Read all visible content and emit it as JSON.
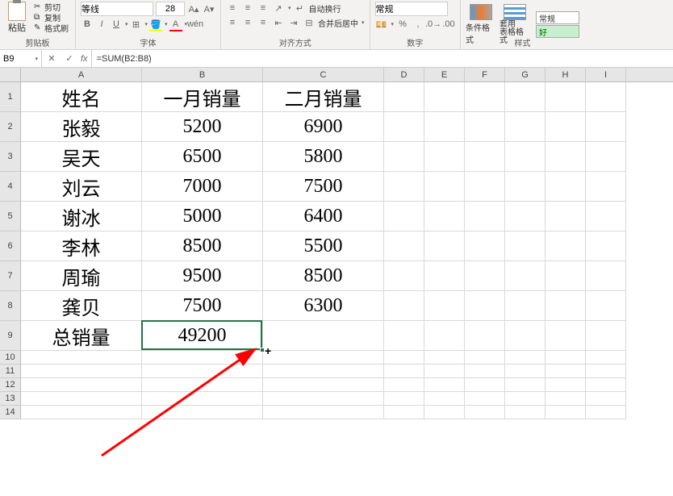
{
  "ribbon": {
    "clipboard": {
      "label": "剪贴板",
      "paste": "粘贴",
      "cut": "剪切",
      "copy": "复制",
      "format_painter": "格式刷"
    },
    "font": {
      "label": "字体",
      "name": "等线",
      "size": "28",
      "bold": "B",
      "italic": "I",
      "underline": "U"
    },
    "alignment": {
      "label": "对齐方式",
      "wrap": "自动换行",
      "merge": "合并后居中"
    },
    "number": {
      "label": "数字",
      "format": "常规"
    },
    "styles": {
      "label": "样式",
      "cond_format": "条件格式",
      "table_format": "套用\n表格格式",
      "normal": "常规",
      "good": "好"
    }
  },
  "formula_bar": {
    "cell_ref": "B9",
    "formula": "=SUM(B2:B8)"
  },
  "columns": [
    "A",
    "B",
    "C",
    "D",
    "E",
    "F",
    "G",
    "H",
    "I"
  ],
  "col_widths": {
    "A": 150,
    "B": 150,
    "C": 150,
    "other": 50
  },
  "row_heights": {
    "data": 37,
    "small": 17
  },
  "rows": [
    "1",
    "2",
    "3",
    "4",
    "5",
    "6",
    "7",
    "8",
    "9",
    "10",
    "11",
    "12",
    "13",
    "14"
  ],
  "chart_data": {
    "type": "table",
    "headers": [
      "姓名",
      "一月销量",
      "二月销量"
    ],
    "records": [
      {
        "name": "张毅",
        "jan": 5200,
        "feb": 6900
      },
      {
        "name": "吴天",
        "jan": 6500,
        "feb": 5800
      },
      {
        "name": "刘云",
        "jan": 7000,
        "feb": 7500
      },
      {
        "name": "谢冰",
        "jan": 5000,
        "feb": 6400
      },
      {
        "name": "李林",
        "jan": 8500,
        "feb": 5500
      },
      {
        "name": "周瑜",
        "jan": 9500,
        "feb": 8500
      },
      {
        "name": "龚贝",
        "jan": 7500,
        "feb": 6300
      }
    ],
    "total_label": "总销量",
    "total_jan": 49200
  },
  "selected_cell": "B9"
}
